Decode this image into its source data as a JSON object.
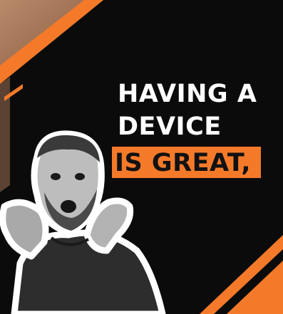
{
  "ad": {
    "headline": [
      "HAVING A",
      "DEVICE",
      "IS GREAT,"
    ]
  },
  "colors": {
    "accent": "#f47a2a",
    "background": "#0b0b0b",
    "headline_text": "#ffffff",
    "highlight_text": "#111111",
    "photo_border": "#ffffff",
    "background_photo": "#a07253"
  },
  "person": {
    "description": "excited-man-photo"
  }
}
